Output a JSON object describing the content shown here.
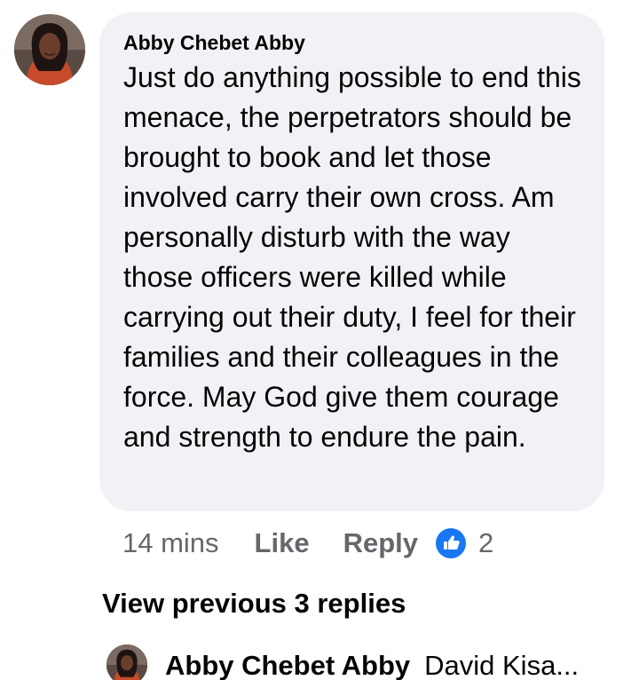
{
  "comment": {
    "author": "Abby Chebet Abby",
    "text": "Just do anything possible to end this menace, the perpetrators should be brought to book and let those involved carry their own cross. Am personally disturb with the way those officers were killed while carrying out their duty, I feel for their families and their colleagues in the force. May God give them courage and strength to endure the pain.",
    "avatar_icon": "profile-photo"
  },
  "actions": {
    "time": "14 mins",
    "like_label": "Like",
    "reply_label": "Reply",
    "reaction_icon": "thumbs-up-icon",
    "reaction_count": "2"
  },
  "replies": {
    "view_previous_label": "View previous 3 replies",
    "latest": {
      "author": "Abby Chebet Abby",
      "preview_text": "David Kisa..."
    }
  },
  "colors": {
    "bubble_bg": "#f0f2f5",
    "secondary_text": "#65676b",
    "like_blue": "#1877f2"
  }
}
